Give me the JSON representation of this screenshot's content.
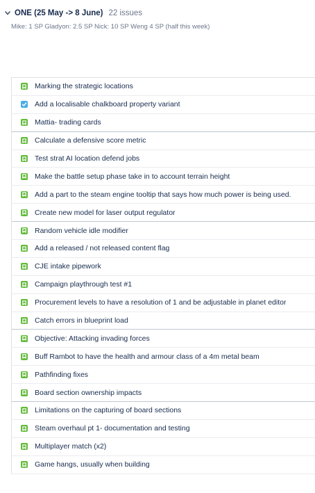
{
  "colors": {
    "story": "#63ba3c",
    "task": "#4bade8"
  },
  "sprint": {
    "name": "ONE (25 May -> 8 June)",
    "issue_count": "22 issues",
    "note": "Mike: 1 SP Gladyon: 2.5 SP Nick: 10 SP Weng 4 SP (half this week)"
  },
  "issues": [
    {
      "type": "story",
      "icon": "story-icon",
      "summary": "Marking the strategic locations"
    },
    {
      "type": "task",
      "icon": "task-icon",
      "summary": "Add a localisable chalkboard property variant"
    },
    {
      "type": "story",
      "icon": "story-icon",
      "summary": "Mattia- trading cards"
    },
    {
      "type": "story",
      "icon": "story-icon",
      "summary": "Calculate a defensive score metric"
    },
    {
      "type": "story",
      "icon": "story-icon",
      "summary": "Test strat AI location defend jobs"
    },
    {
      "type": "story",
      "icon": "story-icon",
      "summary": "Make the battle setup phase take in to account terrain height"
    },
    {
      "type": "story",
      "icon": "story-icon",
      "summary": "Add a part to the steam engine tooltip that says how much power is being used."
    },
    {
      "type": "story",
      "icon": "story-icon",
      "summary": "Create new model for laser output regulator"
    },
    {
      "type": "story",
      "icon": "story-icon",
      "summary": "Random vehicle idle modifier"
    },
    {
      "type": "story",
      "icon": "story-icon",
      "summary": "Add a released / not released content flag"
    },
    {
      "type": "story",
      "icon": "story-icon",
      "summary": "CJE intake pipework"
    },
    {
      "type": "story",
      "icon": "story-icon",
      "summary": "Campaign playthrough test #1"
    },
    {
      "type": "story",
      "icon": "story-icon",
      "summary": "Procurement levels to have a resolution of 1 and be adjustable in planet editor"
    },
    {
      "type": "story",
      "icon": "story-icon",
      "summary": "Catch errors in blueprint load"
    },
    {
      "type": "story",
      "icon": "story-icon",
      "summary": "Objective: Attacking invading forces"
    },
    {
      "type": "story",
      "icon": "story-icon",
      "summary": "Buff Rambot to have the health and armour class of a 4m metal beam"
    },
    {
      "type": "story",
      "icon": "story-icon",
      "summary": "Pathfinding fixes"
    },
    {
      "type": "story",
      "icon": "story-icon",
      "summary": "Board section ownership impacts"
    },
    {
      "type": "story",
      "icon": "story-icon",
      "summary": "Limitations on the capturing of board sections"
    },
    {
      "type": "story",
      "icon": "story-icon",
      "summary": "Steam overhaul pt 1- documentation and testing"
    },
    {
      "type": "story",
      "icon": "story-icon",
      "summary": "Multiplayer match (x2)"
    },
    {
      "type": "story",
      "icon": "story-icon",
      "summary": "Game hangs, usually when building"
    }
  ]
}
